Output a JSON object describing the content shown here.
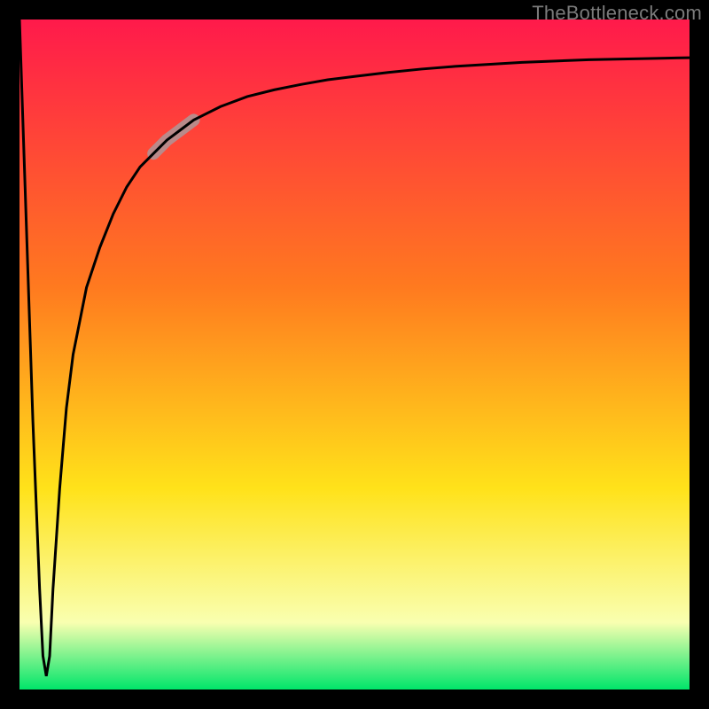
{
  "watermark": "TheBottleneck.com",
  "colors": {
    "frame": "#000000",
    "watermark_text": "#7a7a7a",
    "curve": "#000000",
    "highlight": "#b98a8a",
    "grad_top": "#ff1a4b",
    "grad_mid1": "#ff7a1f",
    "grad_mid2": "#ffe21a",
    "grad_mid3": "#f9ffb0",
    "grad_bottom": "#00e56a"
  },
  "chart_data": {
    "type": "line",
    "title": "",
    "xlabel": "",
    "ylabel": "",
    "xlim": [
      0,
      100
    ],
    "ylim": [
      0,
      100
    ],
    "grid": false,
    "legend": false,
    "annotations": [],
    "x": [
      0,
      1,
      2,
      3,
      3.5,
      4,
      4.5,
      5,
      6,
      7,
      8,
      10,
      12,
      14,
      16,
      18,
      20,
      22,
      24,
      26,
      28,
      30,
      34,
      38,
      42,
      46,
      50,
      55,
      60,
      65,
      70,
      75,
      80,
      85,
      90,
      95,
      100
    ],
    "values": [
      100,
      70,
      40,
      15,
      5,
      2,
      5,
      15,
      30,
      42,
      50,
      60,
      66,
      71,
      75,
      78,
      80,
      82,
      83.5,
      85,
      86,
      87,
      88.5,
      89.5,
      90.3,
      91,
      91.5,
      92.1,
      92.6,
      93,
      93.3,
      93.6,
      93.8,
      94,
      94.1,
      94.2,
      94.3
    ],
    "highlight_range_x": [
      19,
      27
    ],
    "gradient_stops": [
      {
        "pos": 0.0,
        "key": "grad_top"
      },
      {
        "pos": 0.4,
        "key": "grad_mid1"
      },
      {
        "pos": 0.7,
        "key": "grad_mid2"
      },
      {
        "pos": 0.9,
        "key": "grad_mid3"
      },
      {
        "pos": 1.0,
        "key": "grad_bottom"
      }
    ]
  }
}
